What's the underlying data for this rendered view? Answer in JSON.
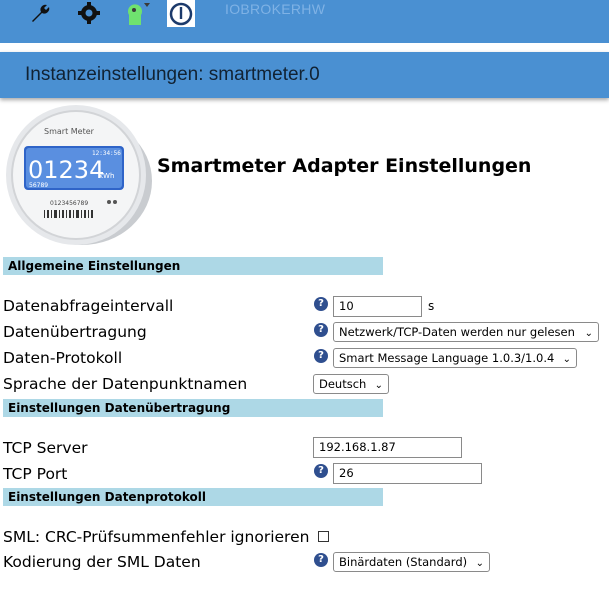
{
  "topbar": {
    "brand": "IOBROKERHW",
    "icons": [
      "wrench-icon",
      "gear-icon",
      "user-help-icon",
      "power-icon"
    ]
  },
  "title": "Instanzeinstellungen: smartmeter.0",
  "header": {
    "title": "Smartmeter Adapter Einstellungen",
    "meter": {
      "brand": "Smart Meter",
      "time": "12:34:56",
      "reading": "01234",
      "unit": "kWh",
      "sub": "56789",
      "serial": "0123456789"
    }
  },
  "sections": {
    "general": "Allgemeine Einstellungen",
    "transfer": "Einstellungen Datenübertragung",
    "protocol": "Einstellungen Datenprotokoll"
  },
  "fields": {
    "interval": {
      "label": "Datenabfrageintervall",
      "value": "10",
      "unit": "s"
    },
    "transmission": {
      "label": "Datenübertragung",
      "value": "Netzwerk/TCP-Daten werden nur gelesen"
    },
    "protocol": {
      "label": "Daten-Protokoll",
      "value": "Smart Message Language 1.0.3/1.0.4"
    },
    "language": {
      "label": "Sprache der Datenpunktnamen",
      "value": "Deutsch"
    },
    "tcp_server": {
      "label": "TCP Server",
      "value": "192.168.1.87"
    },
    "tcp_port": {
      "label": "TCP Port",
      "value": "26"
    },
    "crc": {
      "label": "SML: CRC-Prüfsummenfehler ignorieren",
      "checked": false
    },
    "encoding": {
      "label": "Kodierung der SML Daten",
      "value": "Binärdaten (Standard)"
    }
  },
  "help_glyph": "?",
  "colors": {
    "bar": "#4a90d2",
    "section": "#add8e6",
    "help": "#2f4f8f"
  }
}
